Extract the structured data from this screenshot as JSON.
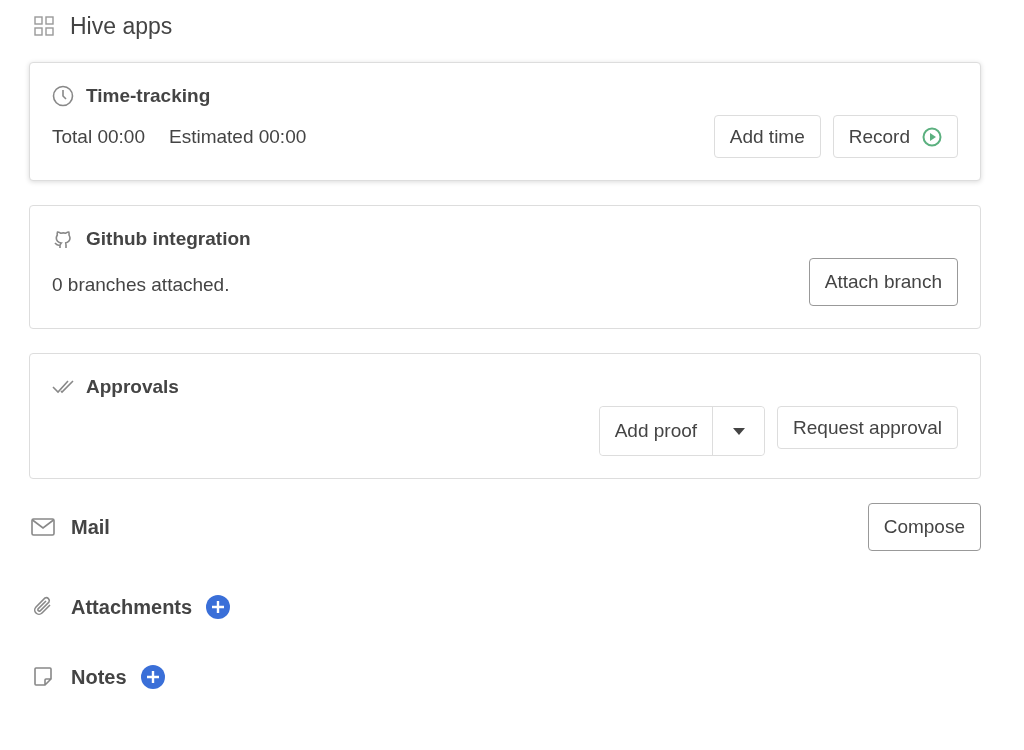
{
  "header": {
    "title": "Hive apps"
  },
  "cards": [
    {
      "kind": "time",
      "title": "Time-tracking",
      "raised": true,
      "details": [
        "Total 00:00",
        "Estimated 00:00"
      ],
      "buttons": [
        {
          "kind": "plain",
          "label": "Add time"
        },
        {
          "kind": "record",
          "label": "Record"
        }
      ]
    },
    {
      "kind": "github",
      "title": "Github integration",
      "raised": false,
      "details": [
        "0 branches attached."
      ],
      "buttons": [
        {
          "kind": "strong",
          "label": "Attach branch"
        }
      ]
    },
    {
      "kind": "approvals",
      "title": "Approvals",
      "raised": false,
      "buttons": [
        {
          "kind": "split",
          "label": "Add proof"
        },
        {
          "kind": "plain",
          "label": "Request approval"
        }
      ]
    }
  ],
  "sections": [
    {
      "kind": "mail",
      "title": "Mail",
      "action": {
        "kind": "button",
        "label": "Compose"
      }
    },
    {
      "kind": "attachments",
      "title": "Attachments",
      "action": {
        "kind": "add"
      }
    },
    {
      "kind": "notes",
      "title": "Notes",
      "action": {
        "kind": "add"
      }
    }
  ]
}
